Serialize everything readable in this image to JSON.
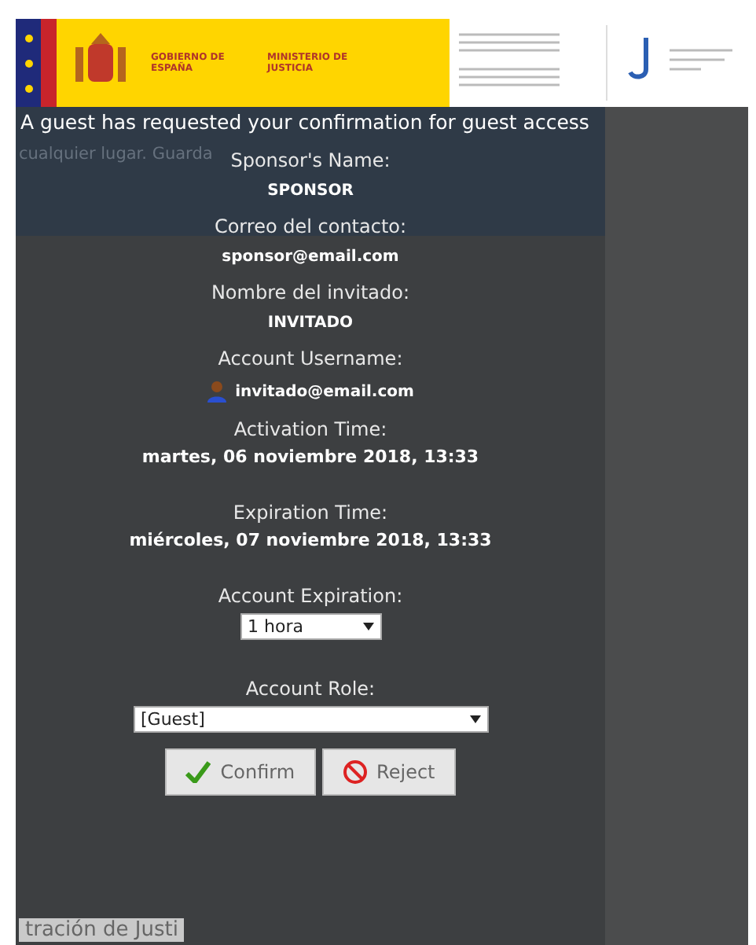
{
  "banner": {
    "government": "GOBIERNO DE ESPAÑA",
    "ministry": "MINISTERIO DE JUSTICIA"
  },
  "background": {
    "top_text": "cualquier lugar. Guarda",
    "bottom_text": "tración de Justi"
  },
  "heading": "A guest has requested your confirmation for guest access",
  "fields": [
    {
      "label": "Sponsor's Name:",
      "value": "SPONSOR",
      "kind": "small"
    },
    {
      "label": "Correo del contacto:",
      "value": "sponsor@email.com",
      "kind": "small"
    },
    {
      "label": "Nombre del invitado:",
      "value": "INVITADO",
      "kind": "small"
    },
    {
      "label": "Account Username:",
      "value": "invitado@email.com",
      "kind": "user"
    },
    {
      "label": "Activation Time:",
      "value": "martes, 06 noviembre 2018, 13:33",
      "kind": "large"
    },
    {
      "label": "Expiration Time:",
      "value": "miércoles, 07 noviembre 2018, 13:33",
      "kind": "large"
    }
  ],
  "account_expiration": {
    "label": "Account Expiration:",
    "value": "1 hora"
  },
  "account_role": {
    "label": "Account Role:",
    "value": "[Guest]"
  },
  "buttons": [
    {
      "label": "Confirm",
      "kind": "confirm"
    },
    {
      "label": "Reject",
      "kind": "reject"
    }
  ]
}
